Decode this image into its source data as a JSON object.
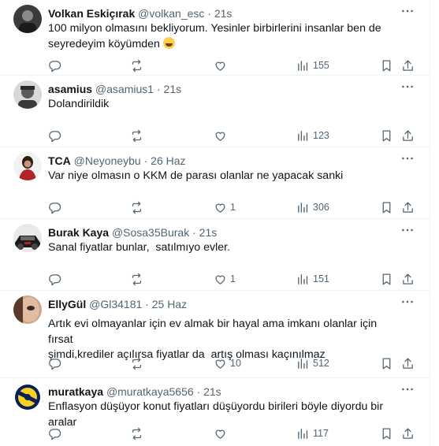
{
  "tweets": [
    {
      "name": "Volkan Eskiçırak",
      "handle": "@volkan_esc",
      "time": "21s",
      "text_line1": "100 milyon olmasını bekliyorum. Yesinler birbirlerini insanlar ben de",
      "text_line2": "seyredeyim köyümden",
      "likes": "",
      "views": "155",
      "avatar": "portrait-dark"
    },
    {
      "name": "asamius",
      "handle": "@asamius1",
      "time": "21s",
      "text": "Dolandirildik",
      "likes": "",
      "views": "123",
      "avatar": "portrait-grayscale"
    },
    {
      "name": "TCA",
      "handle": "@Neyoneybu",
      "time": "26 Haz",
      "text": "Var niye olmasın o KKM de parası olanlar ne yapacak sanki",
      "likes": "1",
      "views": "306",
      "avatar": "woman-silhouette"
    },
    {
      "name": "Burak Kaya",
      "handle": "@Sosa35Burak",
      "time": "21s",
      "text": "Sanal fiyatlar bunlar,  satılmıyo evler.",
      "likes": "1",
      "views": "151",
      "avatar": "dark-car"
    },
    {
      "name": "EllyGül",
      "handle": "@Gl34181",
      "time": "25 Haz",
      "text_line1": "Artık evi olmayanlar için ev almak bir hayal ama imkanı olanlar için fırsat",
      "text_line2": "şimdi,krediler açılırsa fiyatlar da  artış olması kaçınılmaz",
      "likes": "10",
      "views": "512",
      "avatar": "face-closeup"
    },
    {
      "name": "muratkaya",
      "handle": "@muratkaya5656",
      "time": "21s",
      "text": "Enflasyon düşüyor konut fiyatları düşüyordu birileri böyle diyordu bir aralar",
      "likes": "",
      "views": "117",
      "avatar": "club-logo"
    }
  ],
  "ui": {
    "dot": "·",
    "colors": {
      "text": "#0f1419",
      "secondary": "#536471",
      "divider": "#eff3f4"
    },
    "icons": [
      "more-icon",
      "reply-icon",
      "retweet-icon",
      "like-icon",
      "views-icon",
      "bookmark-icon",
      "share-icon"
    ]
  }
}
